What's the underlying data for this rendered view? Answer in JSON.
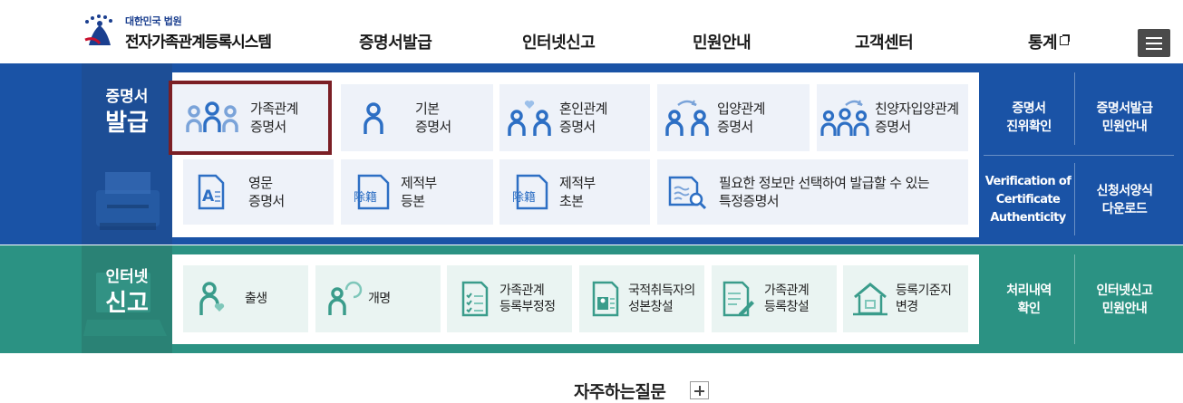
{
  "header": {
    "logo_sub": "대한민국 법원",
    "logo_main": "전자가족관계등록시스템",
    "nav": [
      "증명서발급",
      "인터넷신고",
      "민원안내",
      "고객센터",
      "통계"
    ]
  },
  "certificates": {
    "title_small": "증명서",
    "title_big": "발급",
    "items": [
      {
        "line1": "가족관계",
        "line2": "증명서",
        "icon": "family-icon",
        "selected": true
      },
      {
        "line1": "기본",
        "line2": "증명서",
        "icon": "person-icon"
      },
      {
        "line1": "혼인관계",
        "line2": "증명서",
        "icon": "couple-heart-icon"
      },
      {
        "line1": "입양관계",
        "line2": "증명서",
        "icon": "adoption-icon"
      },
      {
        "line1": "친양자입양관계",
        "line2": "증명서",
        "icon": "full-adoption-icon"
      },
      {
        "line1": "영문",
        "line2": "증명서",
        "icon": "english-document-icon"
      },
      {
        "line1": "제적부",
        "line2": "등본",
        "icon": "removed-register-icon"
      },
      {
        "line1": "제적부",
        "line2": "초본",
        "icon": "removed-register-icon"
      },
      {
        "line1": "필요한 정보만 선택하여 발급할 수 있는",
        "line2": "특정증명서",
        "icon": "document-search-icon"
      }
    ],
    "side_links": [
      {
        "line1": "증명서",
        "line2": "진위확인"
      },
      {
        "line1": "증명서발급",
        "line2": "민원안내"
      },
      {
        "line1": "Verification of",
        "line2": "Certificate",
        "line3": "Authenticity"
      },
      {
        "line1": "신청서양식",
        "line2": "다운로드"
      }
    ],
    "stamp_text": "除籍"
  },
  "internet": {
    "title_small": "인터넷",
    "title_big": "신고",
    "items": [
      {
        "line1": "출생",
        "icon": "birth-icon"
      },
      {
        "line1": "개명",
        "icon": "rename-icon"
      },
      {
        "line1": "가족관계",
        "line2": "등록부정정",
        "icon": "checklist-icon"
      },
      {
        "line1": "국적취득자의",
        "line2": "성본창설",
        "icon": "id-card-icon"
      },
      {
        "line1": "가족관계",
        "line2": "등록창설",
        "icon": "document-pen-icon"
      },
      {
        "line1": "등록기준지",
        "line2": "변경",
        "icon": "house-icon"
      }
    ],
    "side_links": [
      {
        "line1": "처리내역",
        "line2": "확인"
      },
      {
        "line1": "인터넷신고",
        "line2": "민원안내"
      }
    ]
  },
  "faq": {
    "label": "자주하는질문"
  },
  "colors": {
    "primary": "#1a53a6",
    "teal": "#2b9283",
    "selected_border": "#7b1f25",
    "icon_blue": "#2d6fc4",
    "icon_teal": "#3a9c8b"
  }
}
